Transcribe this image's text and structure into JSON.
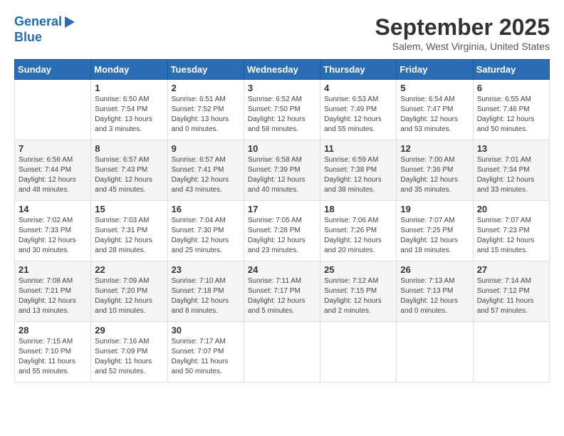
{
  "logo": {
    "line1": "General",
    "line2": "Blue"
  },
  "title": {
    "month_year": "September 2025",
    "location": "Salem, West Virginia, United States"
  },
  "calendar": {
    "headers": [
      "Sunday",
      "Monday",
      "Tuesday",
      "Wednesday",
      "Thursday",
      "Friday",
      "Saturday"
    ],
    "weeks": [
      [
        {
          "day": "",
          "info": ""
        },
        {
          "day": "1",
          "info": "Sunrise: 6:50 AM\nSunset: 7:54 PM\nDaylight: 13 hours\nand 3 minutes."
        },
        {
          "day": "2",
          "info": "Sunrise: 6:51 AM\nSunset: 7:52 PM\nDaylight: 13 hours\nand 0 minutes."
        },
        {
          "day": "3",
          "info": "Sunrise: 6:52 AM\nSunset: 7:50 PM\nDaylight: 12 hours\nand 58 minutes."
        },
        {
          "day": "4",
          "info": "Sunrise: 6:53 AM\nSunset: 7:49 PM\nDaylight: 12 hours\nand 55 minutes."
        },
        {
          "day": "5",
          "info": "Sunrise: 6:54 AM\nSunset: 7:47 PM\nDaylight: 12 hours\nand 53 minutes."
        },
        {
          "day": "6",
          "info": "Sunrise: 6:55 AM\nSunset: 7:46 PM\nDaylight: 12 hours\nand 50 minutes."
        }
      ],
      [
        {
          "day": "7",
          "info": "Sunrise: 6:56 AM\nSunset: 7:44 PM\nDaylight: 12 hours\nand 48 minutes."
        },
        {
          "day": "8",
          "info": "Sunrise: 6:57 AM\nSunset: 7:43 PM\nDaylight: 12 hours\nand 45 minutes."
        },
        {
          "day": "9",
          "info": "Sunrise: 6:57 AM\nSunset: 7:41 PM\nDaylight: 12 hours\nand 43 minutes."
        },
        {
          "day": "10",
          "info": "Sunrise: 6:58 AM\nSunset: 7:39 PM\nDaylight: 12 hours\nand 40 minutes."
        },
        {
          "day": "11",
          "info": "Sunrise: 6:59 AM\nSunset: 7:38 PM\nDaylight: 12 hours\nand 38 minutes."
        },
        {
          "day": "12",
          "info": "Sunrise: 7:00 AM\nSunset: 7:36 PM\nDaylight: 12 hours\nand 35 minutes."
        },
        {
          "day": "13",
          "info": "Sunrise: 7:01 AM\nSunset: 7:34 PM\nDaylight: 12 hours\nand 33 minutes."
        }
      ],
      [
        {
          "day": "14",
          "info": "Sunrise: 7:02 AM\nSunset: 7:33 PM\nDaylight: 12 hours\nand 30 minutes."
        },
        {
          "day": "15",
          "info": "Sunrise: 7:03 AM\nSunset: 7:31 PM\nDaylight: 12 hours\nand 28 minutes."
        },
        {
          "day": "16",
          "info": "Sunrise: 7:04 AM\nSunset: 7:30 PM\nDaylight: 12 hours\nand 25 minutes."
        },
        {
          "day": "17",
          "info": "Sunrise: 7:05 AM\nSunset: 7:28 PM\nDaylight: 12 hours\nand 23 minutes."
        },
        {
          "day": "18",
          "info": "Sunrise: 7:06 AM\nSunset: 7:26 PM\nDaylight: 12 hours\nand 20 minutes."
        },
        {
          "day": "19",
          "info": "Sunrise: 7:07 AM\nSunset: 7:25 PM\nDaylight: 12 hours\nand 18 minutes."
        },
        {
          "day": "20",
          "info": "Sunrise: 7:07 AM\nSunset: 7:23 PM\nDaylight: 12 hours\nand 15 minutes."
        }
      ],
      [
        {
          "day": "21",
          "info": "Sunrise: 7:08 AM\nSunset: 7:21 PM\nDaylight: 12 hours\nand 13 minutes."
        },
        {
          "day": "22",
          "info": "Sunrise: 7:09 AM\nSunset: 7:20 PM\nDaylight: 12 hours\nand 10 minutes."
        },
        {
          "day": "23",
          "info": "Sunrise: 7:10 AM\nSunset: 7:18 PM\nDaylight: 12 hours\nand 8 minutes."
        },
        {
          "day": "24",
          "info": "Sunrise: 7:11 AM\nSunset: 7:17 PM\nDaylight: 12 hours\nand 5 minutes."
        },
        {
          "day": "25",
          "info": "Sunrise: 7:12 AM\nSunset: 7:15 PM\nDaylight: 12 hours\nand 2 minutes."
        },
        {
          "day": "26",
          "info": "Sunrise: 7:13 AM\nSunset: 7:13 PM\nDaylight: 12 hours\nand 0 minutes."
        },
        {
          "day": "27",
          "info": "Sunrise: 7:14 AM\nSunset: 7:12 PM\nDaylight: 11 hours\nand 57 minutes."
        }
      ],
      [
        {
          "day": "28",
          "info": "Sunrise: 7:15 AM\nSunset: 7:10 PM\nDaylight: 11 hours\nand 55 minutes."
        },
        {
          "day": "29",
          "info": "Sunrise: 7:16 AM\nSunset: 7:09 PM\nDaylight: 11 hours\nand 52 minutes."
        },
        {
          "day": "30",
          "info": "Sunrise: 7:17 AM\nSunset: 7:07 PM\nDaylight: 11 hours\nand 50 minutes."
        },
        {
          "day": "",
          "info": ""
        },
        {
          "day": "",
          "info": ""
        },
        {
          "day": "",
          "info": ""
        },
        {
          "day": "",
          "info": ""
        }
      ]
    ]
  }
}
